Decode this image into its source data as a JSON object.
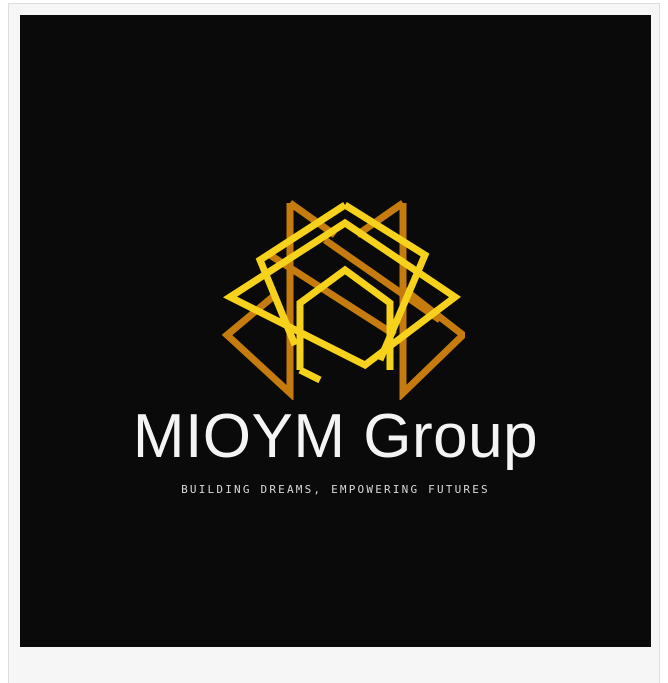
{
  "logo": {
    "brand_name": "MIOYM Group",
    "tagline": "BUILDING DREAMS, EMPOWERING FUTURES",
    "emblem_icon": "interlaced-house-icon",
    "colors": {
      "background": "#0a0a0a",
      "gold_bright": "#f7d21c",
      "gold_dark": "#c67b0e",
      "text": "#f4f4f4"
    }
  }
}
